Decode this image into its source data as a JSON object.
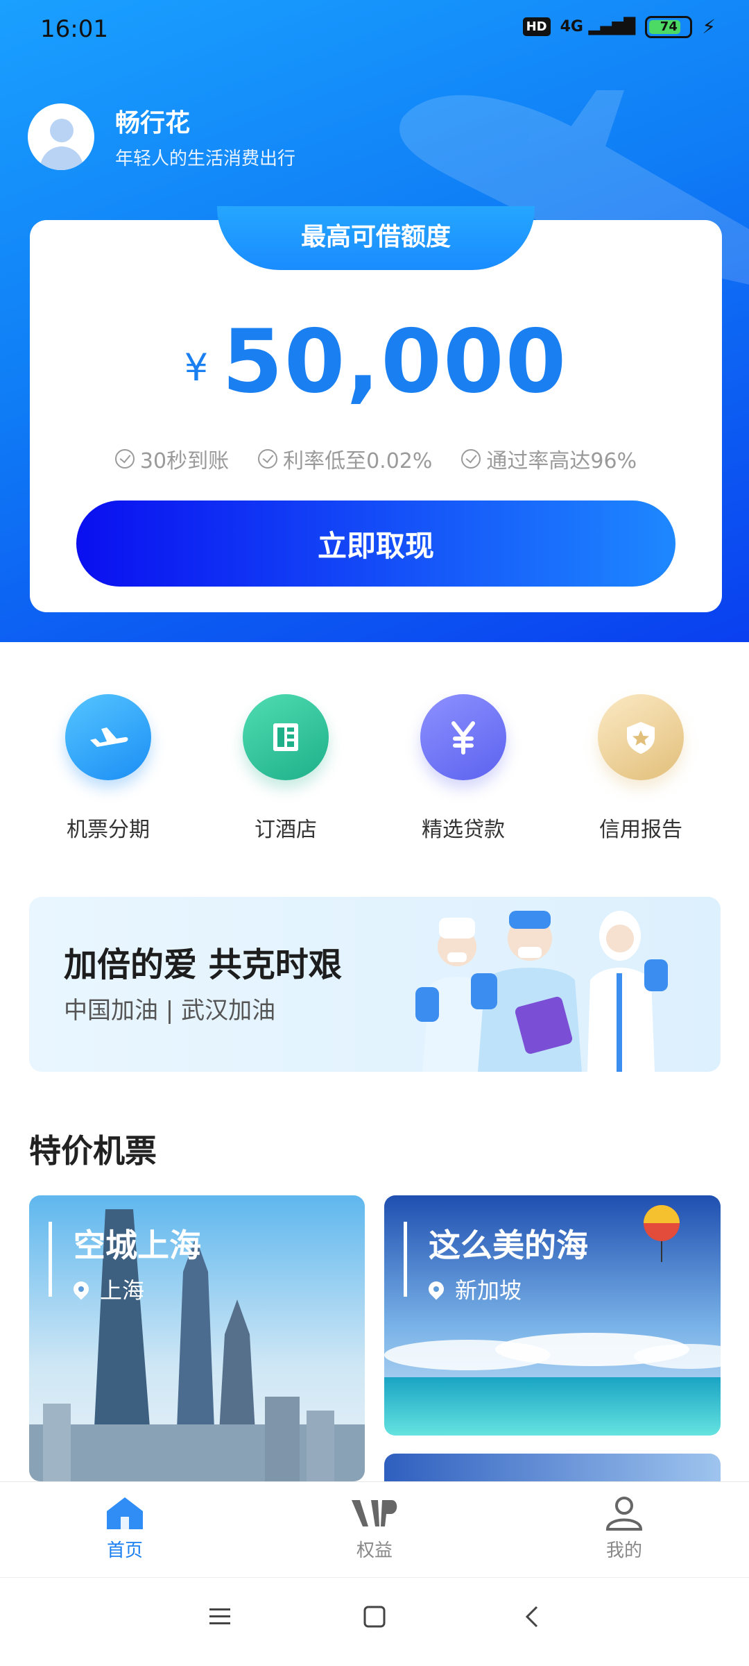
{
  "status_bar": {
    "time": "16:01",
    "hd": "HD",
    "network": "4G",
    "battery": "74"
  },
  "user": {
    "name": "畅行花",
    "slogan": "年轻人的生活消费出行"
  },
  "credit_card": {
    "tab_label": "最高可借额度",
    "currency": "¥",
    "amount": "50,000",
    "features": [
      "30秒到账",
      "利率低至0.02%",
      "通过率高达96%"
    ],
    "cta_label": "立即取现"
  },
  "quick_actions": [
    {
      "label": "机票分期",
      "icon": "airplane-icon"
    },
    {
      "label": "订酒店",
      "icon": "hotel-icon"
    },
    {
      "label": "精选贷款",
      "icon": "yen-icon"
    },
    {
      "label": "信用报告",
      "icon": "shield-star-icon"
    }
  ],
  "banner": {
    "title": "加倍的爱 共克时艰",
    "subtitle": "中国加油 | 武汉加油"
  },
  "special_flights": {
    "title": "特价机票",
    "cards": [
      {
        "title": "空城上海",
        "location": "上海"
      },
      {
        "title": "这么美的海",
        "location": "新加坡"
      }
    ]
  },
  "tabbar": {
    "items": [
      {
        "label": "首页",
        "icon": "home-icon",
        "active": true
      },
      {
        "label": "权益",
        "icon": "vip-icon",
        "active": false
      },
      {
        "label": "我的",
        "icon": "profile-icon",
        "active": false
      }
    ]
  },
  "colors": {
    "primary": "#1a7ff0",
    "cta_start": "#0a0ff0",
    "cta_end": "#1e88ff"
  }
}
